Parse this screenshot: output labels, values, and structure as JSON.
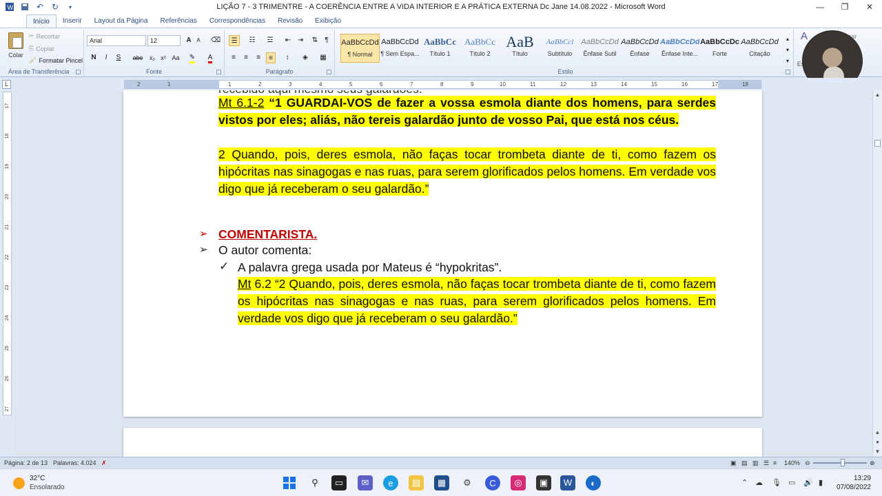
{
  "window": {
    "title": "LIÇÃO 7 - 3 TRIMENTRE - A COERÊNCIA ENTRE A VIDA INTERIOR E A PRÁTICA EXTERNA Dc Jane 14.08.2022 - Microsoft Word"
  },
  "tabs": [
    "Início",
    "Inserir",
    "Layout da Página",
    "Referências",
    "Correspondências",
    "Revisão",
    "Exibição"
  ],
  "clipboard": {
    "paste": "Colar",
    "cut": "Recortar",
    "copy": "Copiar",
    "format_painter": "Formatar Pincel",
    "group_label": "Área de Transferência"
  },
  "font": {
    "name": "Arial",
    "size": "12",
    "group_label": "Fonte",
    "bold": "N",
    "italic": "I",
    "underline": "S",
    "strike": "abc",
    "sub": "x₂",
    "sup": "x²",
    "case": "Aa",
    "grow": "A",
    "shrink": "A"
  },
  "paragraph": {
    "group_label": "Parágrafo",
    "pilcrow": "¶"
  },
  "styles": {
    "group_label": "Estilo",
    "items": [
      {
        "preview": "AaBbCcDd",
        "name": "¶ Normal"
      },
      {
        "preview": "AaBbCcDd",
        "name": "¶ Sem Espa..."
      },
      {
        "preview": "AaBbCc",
        "name": "Título 1"
      },
      {
        "preview": "AaBbCc",
        "name": "Título 2"
      },
      {
        "preview": "AaB",
        "name": "Título"
      },
      {
        "preview": "AaBbCcl",
        "name": "Subtítulo"
      },
      {
        "preview": "AaBbCcDd",
        "name": "Ênfase Sutil"
      },
      {
        "preview": "AaBbCcDd",
        "name": "Ênfase"
      },
      {
        "preview": "AaBbCcDd",
        "name": "Ênfase Inte..."
      },
      {
        "preview": "AaBbCcDc",
        "name": "Forte"
      },
      {
        "preview": "AaBbCcDd",
        "name": "Citação"
      }
    ],
    "change": "Alterar",
    "edit": "Es"
  },
  "ruler": {
    "marks": [
      "2",
      "1",
      "1",
      "2",
      "3",
      "4",
      "5",
      "6",
      "7",
      "8",
      "9",
      "10",
      "11",
      "12",
      "13",
      "14",
      "15",
      "16",
      "17",
      "18"
    ],
    "vmarks": [
      "17",
      "18",
      "19",
      "20",
      "21",
      "22",
      "23",
      "24",
      "25",
      "26",
      "27"
    ]
  },
  "document": {
    "cutoff_line": "recebido aqui mesmo seus galardões.",
    "p1_ref": "Mt 6.1-2",
    "p1_open": " “",
    "p1_text": "1  GUARDAI-VOS de fazer a vossa esmola diante dos homens, para serdes vistos por eles; aliás, não tereis galardão junto de vosso Pai, que está nos céus.",
    "p2_text": "2  Quando, pois, deres esmola, não faças tocar trombeta diante de ti, como fazem os hipócritas nas sinagogas e nas ruas, para serem glorificados pelos homens. Em verdade vos digo que já receberam o seu galardão.”",
    "heading": "COMENTARISTA.",
    "bullet2": "O autor comenta:",
    "check_text": "A palavra grega usada por Mateus é “hypokritas”.",
    "quote_ref": "Mt",
    "quote_text": " 6.2 “2  Quando, pois, deres esmola, não faças tocar trombeta diante de ti, como fazem os hipócritas nas sinagogas e nas ruas, para serem glorificados pelos homens. Em verdade vos digo que já receberam o seu galardão.”",
    "arrow_bullet": "➢",
    "check_bullet": "✓"
  },
  "statusbar": {
    "page": "Página: 2 de 13",
    "words": "Palavras: 4.024",
    "zoom": "140%"
  },
  "taskbar": {
    "temp": "32°C",
    "weather": "Ensolarado",
    "time": "13:29",
    "date": "07/08/2022"
  },
  "colors": {
    "highlight": "#ffff00",
    "heading_red": "#c00000",
    "word_blue": "#2b579a"
  }
}
